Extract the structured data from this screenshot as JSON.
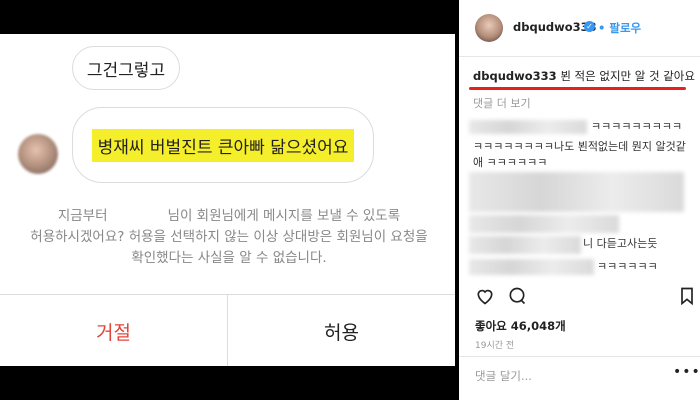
{
  "dm": {
    "bubble_1": "그건그렇고",
    "bubble_2": "병재씨 버벌진트 큰아빠 닮으셨어요",
    "notice_line1_pre": "지금부터",
    "notice_line1_post": "님이 회원님에게 메시지를 보낼 수 있도록",
    "notice_line2": "허용하시겠어요? 허용을 선택하지 않는 이상 상대방은 회원님이 요청을",
    "notice_line3": "확인했다는 사실을 알 수 없습니다.",
    "reject_label": "거절",
    "allow_label": "허용",
    "reject_color": "#e0453a"
  },
  "post": {
    "username": "dbqudwo333",
    "follow_label": "팔로우",
    "caption_user": "dbqudwo333",
    "caption_text": "뵌 적은 없지만 알 것 같아요",
    "more_comments": "댓글 더 보기",
    "comments": [
      "ㅋㅋㅋㅋㅋㅋㅋㅋㅋ",
      "ㅋㅋㅋㅋㅋㅋㅋㅋ나도 뵌적없는데 뭔지 알것같",
      "애 ㅋㅋㅋㅋㅋㅋ",
      "니 다듣고사는듯",
      "ㅋㅋㅋㅋㅋㅋ"
    ],
    "likes": "좋아요 46,048개",
    "time": "19시간 전",
    "comment_placeholder": "댓글 달기...",
    "more_icon": "ellipsis-icon",
    "accent_color": "#3897f0"
  }
}
